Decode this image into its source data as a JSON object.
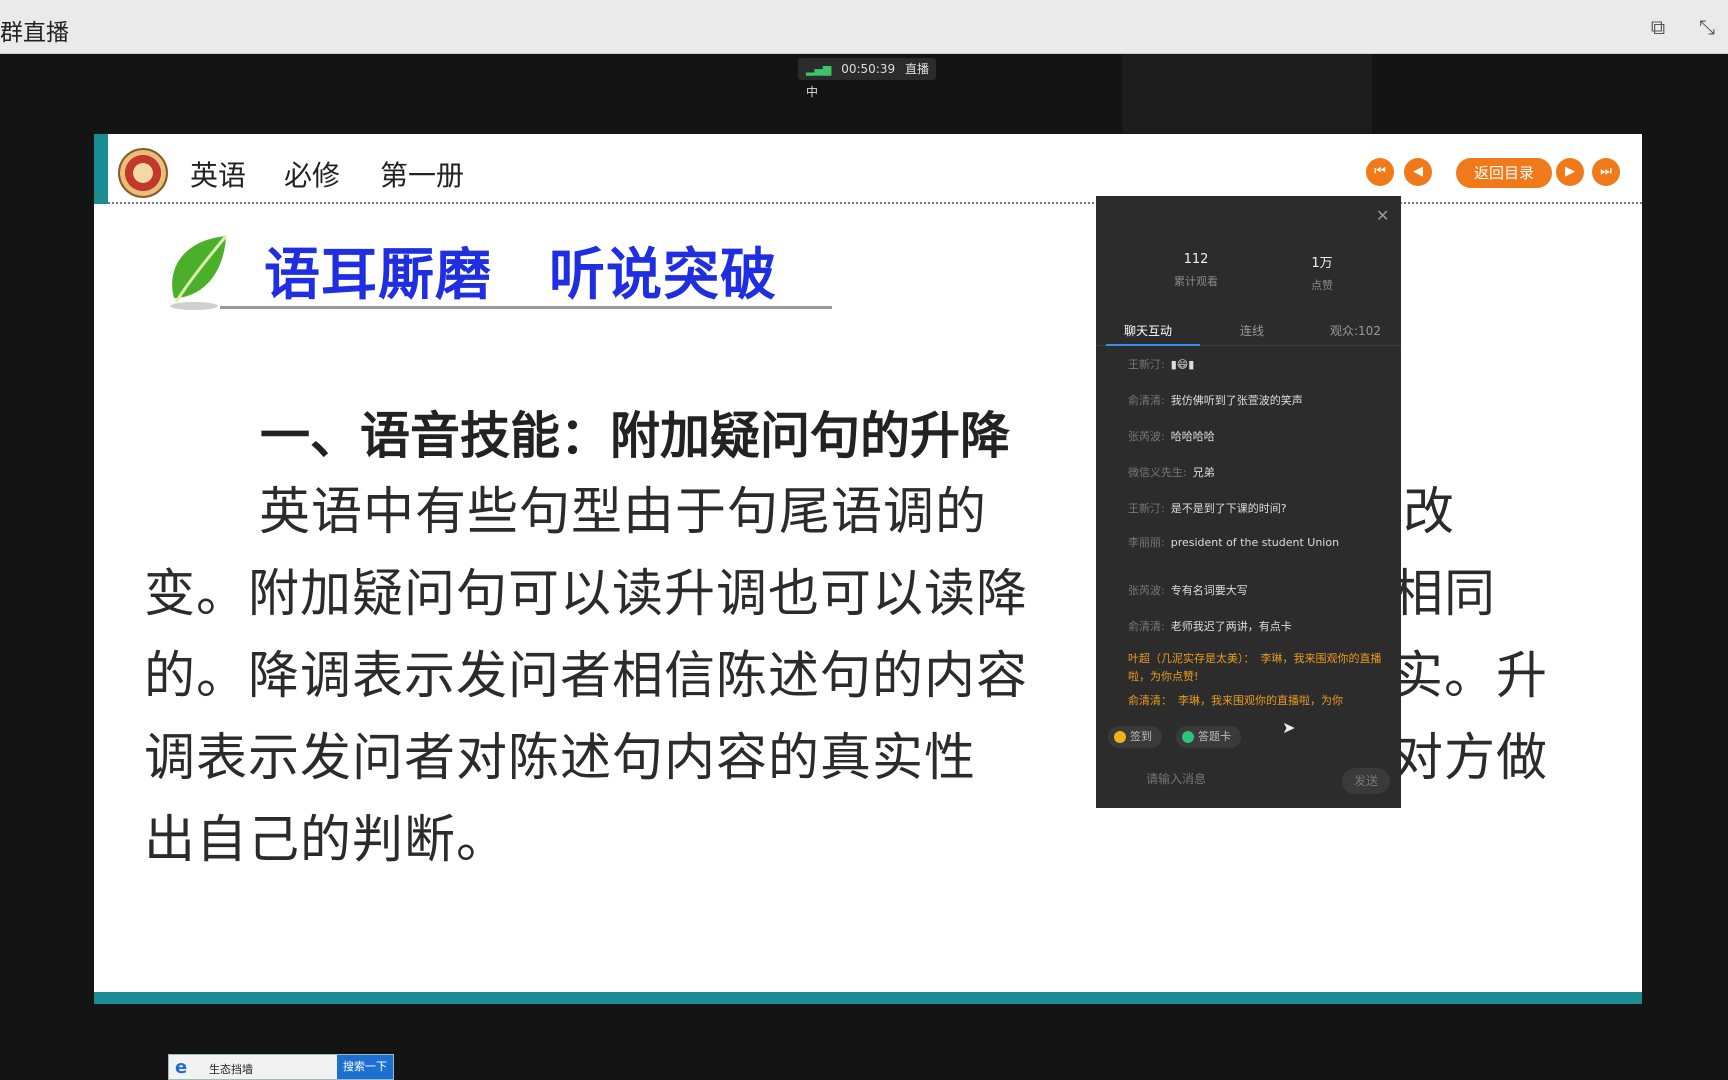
{
  "window": {
    "title": "群直播"
  },
  "live": {
    "timer": "00:50:39",
    "status": "直播中"
  },
  "slide": {
    "breadcrumb": [
      "英语",
      "必修",
      "第一册"
    ],
    "toc_button": "返回目录",
    "section_title": "语耳厮磨　听说突破",
    "heading": "一、语音技能：附加疑问句的升降",
    "body": "英语中有些句型由于句尾语调的　　　　　起意义改变。附加疑问句可以读升调也可以读降　　　　　是不相同的。降调表示发问者相信陈述句的内容　　　　　方证实。升调表示发问者对陈述句内容的真实性　　　　　，希望对方做出自己的判断。",
    "accent_color": "#1a8c93",
    "title_color": "#1f2ee0",
    "nav_color": "#f07a1a"
  },
  "chat": {
    "stats": {
      "views_count": "112",
      "views_label": "累计观看",
      "likes_count": "1万",
      "likes_label": "点赞"
    },
    "tabs": [
      "聊天互动",
      "连线",
      "观众:102"
    ],
    "messages": [
      {
        "user": "王新汀:",
        "text": "▮😄▮"
      },
      {
        "user": "俞清清:",
        "text": "我仿佛听到了张萱波的笑声"
      },
      {
        "user": "张芮波:",
        "text": "哈哈哈哈"
      },
      {
        "user": "微信义先生:",
        "text": "兄弟"
      },
      {
        "user": "王新汀:",
        "text": "是不是到了下课的时间?"
      },
      {
        "user": "李丽丽:",
        "text": "president of the student Union"
      },
      {
        "user": "张芮波:",
        "text": "专有名词要大写"
      },
      {
        "user": "俞清清:",
        "text": "老师我迟了两讲，有点卡"
      },
      {
        "user": "叶超（几泥实存是太美）：",
        "text": "李琳，我来围观你的直播啦，为你点赞!"
      },
      {
        "user": "俞清清：",
        "text": "李琳，我来围观你的直播啦，为你"
      }
    ],
    "chip_sign": "签到",
    "chip_answer": "答题卡",
    "input_placeholder": "请输入消息",
    "send_label": "发送"
  },
  "taskbar": {
    "search_label": "生态挡墙",
    "search_button": "搜索一下"
  }
}
